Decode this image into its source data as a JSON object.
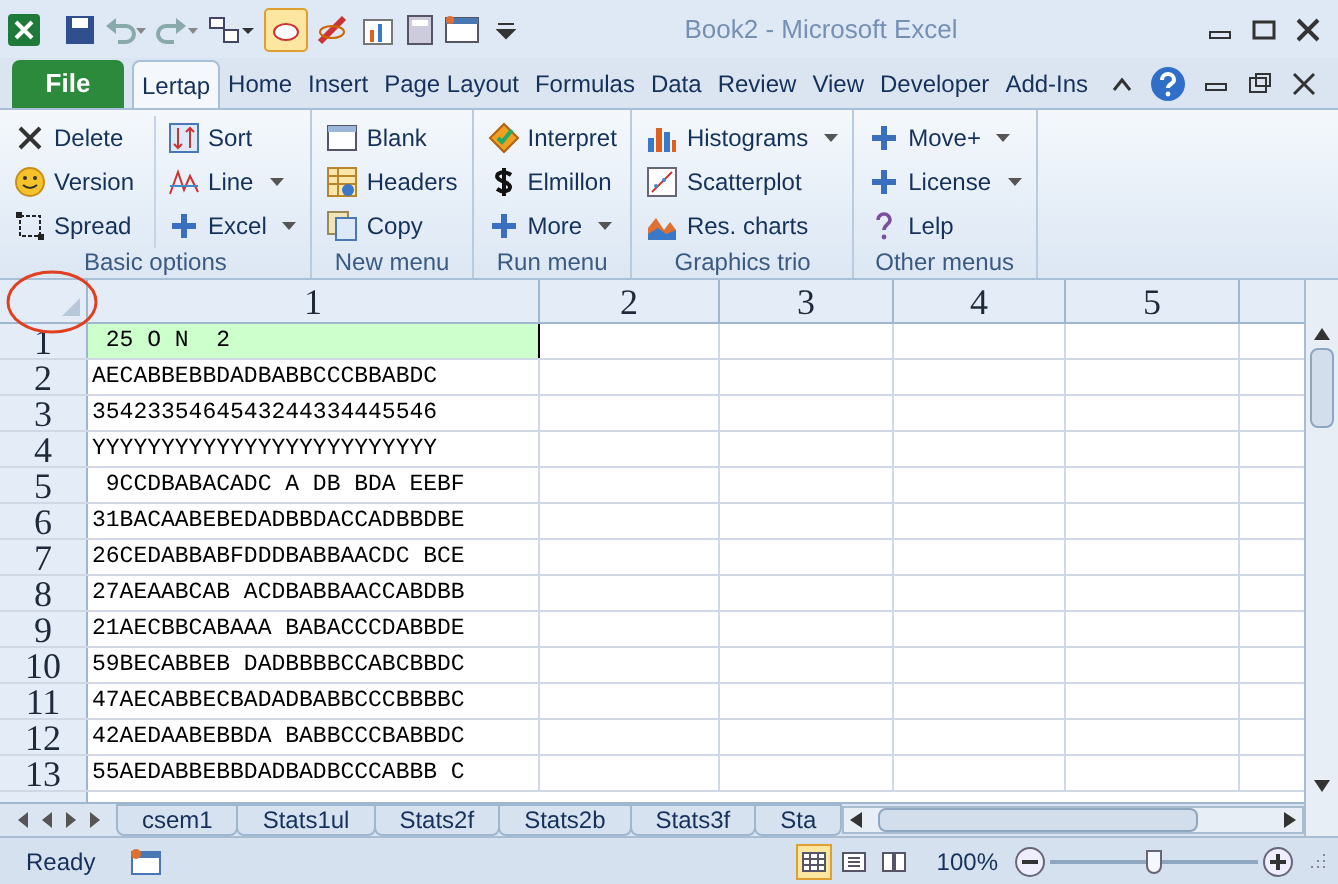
{
  "window": {
    "title": "Book2  -  Microsoft Excel"
  },
  "ribbon_tabs": [
    {
      "label": "File",
      "kind": "file",
      "selected": false
    },
    {
      "label": "Lertap",
      "kind": "tab",
      "selected": true
    },
    {
      "label": "Home",
      "kind": "tab",
      "selected": false
    },
    {
      "label": "Insert",
      "kind": "tab",
      "selected": false
    },
    {
      "label": "Page Layout",
      "kind": "tab",
      "selected": false
    },
    {
      "label": "Formulas",
      "kind": "tab",
      "selected": false
    },
    {
      "label": "Data",
      "kind": "tab",
      "selected": false
    },
    {
      "label": "Review",
      "kind": "tab",
      "selected": false
    },
    {
      "label": "View",
      "kind": "tab",
      "selected": false
    },
    {
      "label": "Developer",
      "kind": "tab",
      "selected": false
    },
    {
      "label": "Add-Ins",
      "kind": "tab",
      "selected": false
    }
  ],
  "ribbon_groups": [
    {
      "label": "Basic options",
      "columns": [
        [
          {
            "label": "Delete",
            "dropdown": false
          },
          {
            "label": "Version",
            "dropdown": false
          },
          {
            "label": "Spread",
            "dropdown": false
          }
        ],
        [
          {
            "label": "Sort",
            "dropdown": false
          },
          {
            "label": "Line",
            "dropdown": true
          },
          {
            "label": "Excel",
            "dropdown": true
          }
        ]
      ]
    },
    {
      "label": "New menu",
      "columns": [
        [
          {
            "label": "Blank",
            "dropdown": false
          },
          {
            "label": "Headers",
            "dropdown": false
          },
          {
            "label": "Copy",
            "dropdown": false
          }
        ]
      ]
    },
    {
      "label": "Run menu",
      "columns": [
        [
          {
            "label": "Interpret",
            "dropdown": false
          },
          {
            "label": "Elmillon",
            "dropdown": false
          },
          {
            "label": "More",
            "dropdown": true
          }
        ]
      ]
    },
    {
      "label": "Graphics trio",
      "columns": [
        [
          {
            "label": "Histograms",
            "dropdown": true
          },
          {
            "label": "Scatterplot",
            "dropdown": false
          },
          {
            "label": "Res. charts",
            "dropdown": false
          }
        ]
      ]
    },
    {
      "label": "Other menus",
      "columns": [
        [
          {
            "label": "Move+",
            "dropdown": true
          },
          {
            "label": "License",
            "dropdown": true
          },
          {
            "label": "Lelp",
            "dropdown": false
          }
        ]
      ]
    }
  ],
  "sheet": {
    "columns": [
      "1",
      "2",
      "3",
      "4",
      "5"
    ],
    "rows": [
      {
        "header": "1",
        "cell": " 25 O N  2",
        "highlighted": true
      },
      {
        "header": "2",
        "cell": "AECABBEBBDADBABBCCCBBABDC",
        "highlighted": false
      },
      {
        "header": "3",
        "cell": "3542335464543244334445546",
        "highlighted": false
      },
      {
        "header": "4",
        "cell": "YYYYYYYYYYYYYYYYYYYYYYYYY",
        "highlighted": false
      },
      {
        "header": "5",
        "cell": " 9CCDBABACADC A DB BDA EEBF",
        "highlighted": false
      },
      {
        "header": "6",
        "cell": "31BACAABEBEDADBBDACCADBBDBE",
        "highlighted": false
      },
      {
        "header": "7",
        "cell": "26CEDABBABFDDDBABBAACDC BCE",
        "highlighted": false
      },
      {
        "header": "8",
        "cell": "27AEAABCAB ACDBABBAACCABDBB",
        "highlighted": false
      },
      {
        "header": "9",
        "cell": "21AECBBCABAAA BABACCCDABBDE",
        "highlighted": false
      },
      {
        "header": "10",
        "cell": "59BECABBEB DADBBBBCCABCBBDC",
        "highlighted": false
      },
      {
        "header": "11",
        "cell": "47AECABBECBADADBABBCCCBBBBC",
        "highlighted": false
      },
      {
        "header": "12",
        "cell": "42AEDAABEBBDA BABBCCCBABBDC",
        "highlighted": false
      },
      {
        "header": "13",
        "cell": "55AEDABBEBBDADBADBCCCABBB C",
        "highlighted": false
      }
    ]
  },
  "sheet_tabs": [
    "csem1",
    "Stats1ul",
    "Stats2f",
    "Stats2b",
    "Stats3f",
    "Sta"
  ],
  "status_bar": {
    "status": "Ready",
    "views": [
      {
        "selected": true
      },
      {
        "selected": false
      },
      {
        "selected": false
      }
    ],
    "zoom": "100%",
    "zoom_slider": {
      "level": 0.5
    }
  }
}
